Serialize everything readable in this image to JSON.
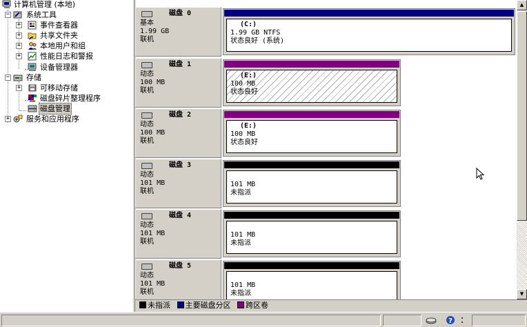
{
  "tree": {
    "root": "计算机管理 (本地)",
    "system_tools": "系统工具",
    "event_viewer": "事件查看器",
    "shared_folders": "共享文件夹",
    "local_users": "本地用户和组",
    "perf_logs": "性能日志和警报",
    "device_manager": "设备管理器",
    "storage": "存储",
    "removable_storage": "可移动存储",
    "defrag": "磁盘碎片整理程序",
    "disk_mgmt": "磁盘管理",
    "services_apps": "服务和应用程序"
  },
  "disks": [
    {
      "name": "磁盘 0",
      "type": "基本",
      "size": "1.99 GB",
      "status": "联机",
      "volume": {
        "name": "(C:)",
        "line1": "1.99 GB NTFS",
        "line2": "状态良好 (系统)",
        "bar_color": "#000080",
        "hatched": false
      }
    },
    {
      "name": "磁盘 1",
      "type": "动态",
      "size": "100 MB",
      "status": "联机",
      "volume": {
        "name": "(E:)",
        "line1": "100 MB",
        "line2": "状态良好",
        "bar_color": "#800080",
        "hatched": true
      }
    },
    {
      "name": "磁盘 2",
      "type": "动态",
      "size": "100 MB",
      "status": "联机",
      "volume": {
        "name": "(E:)",
        "line1": "100 MB",
        "line2": "状态良好",
        "bar_color": "#800080",
        "hatched": false
      }
    },
    {
      "name": "磁盘 3",
      "type": "动态",
      "size": "101 MB",
      "status": "联机",
      "volume": {
        "name": "",
        "line1": "101 MB",
        "line2": "未指派",
        "bar_color": "#000000",
        "hatched": false
      }
    },
    {
      "name": "磁盘 4",
      "type": "动态",
      "size": "101 MB",
      "status": "联机",
      "volume": {
        "name": "",
        "line1": "101 MB",
        "line2": "未指派",
        "bar_color": "#000000",
        "hatched": false
      }
    },
    {
      "name": "磁盘 5",
      "type": "动态",
      "size": "101 MB",
      "status": "联机",
      "volume": {
        "name": "",
        "line1": "101 MB",
        "line2": "未指派",
        "bar_color": "#000000",
        "hatched": false
      }
    }
  ],
  "legend": {
    "unallocated": "未指派",
    "primary": "主要磁盘分区",
    "spanned": "跨区卷",
    "colors": {
      "unallocated": "#000000",
      "primary": "#000080",
      "spanned": "#800080"
    }
  }
}
